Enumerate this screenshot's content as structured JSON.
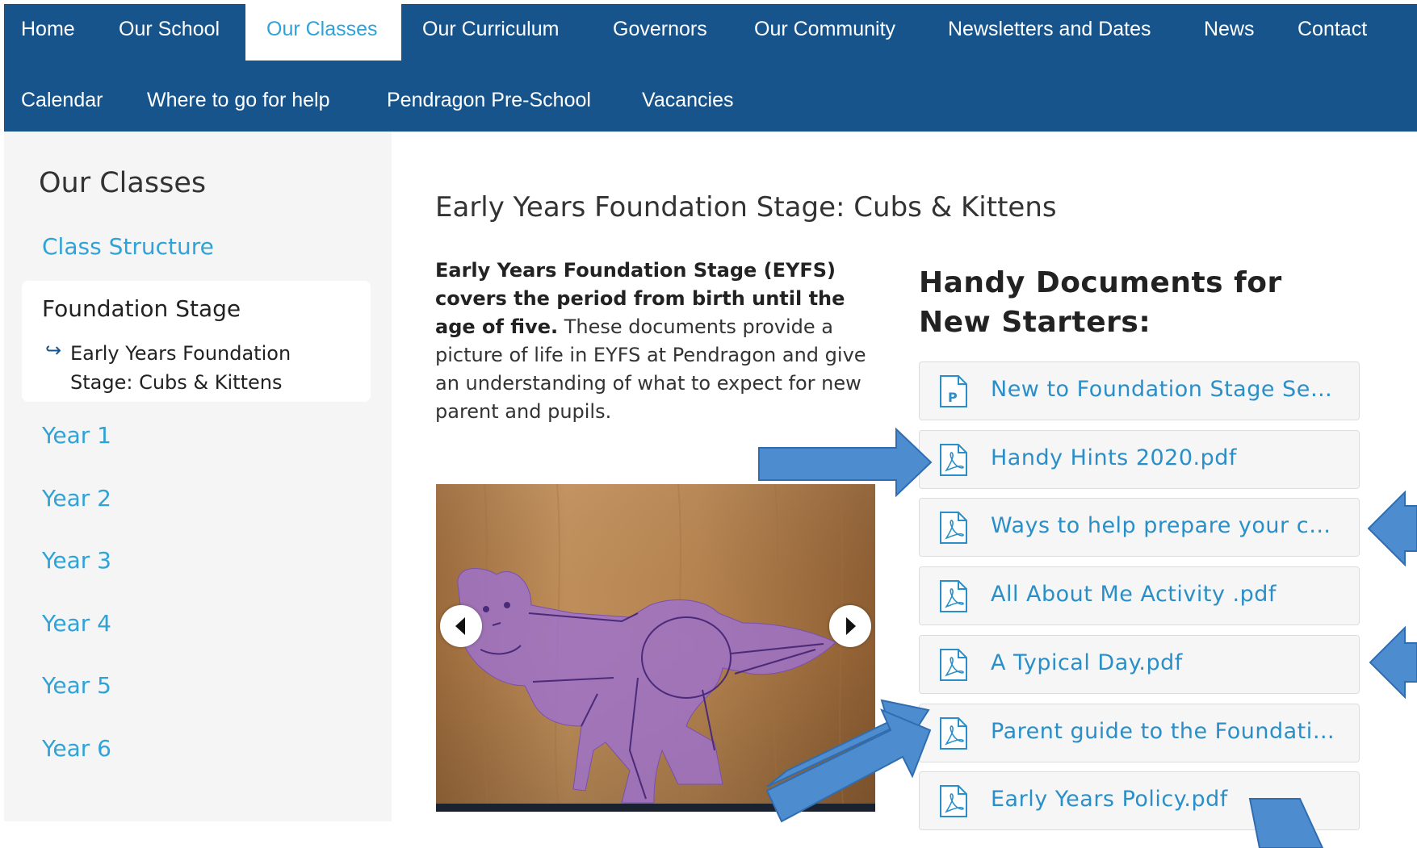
{
  "nav": {
    "row1": [
      "Home",
      "Our School",
      "Our Classes",
      "Our Curriculum",
      "Governors",
      "Our Community",
      "Newsletters and Dates",
      "News",
      "Contact"
    ],
    "row2": [
      "Calendar",
      "Where to go for help",
      "Pendragon Pre-School",
      "Vacancies"
    ],
    "active": "Our Classes"
  },
  "sidebar": {
    "title": "Our Classes",
    "class_structure": "Class Structure",
    "current": "Foundation Stage",
    "current_sub": "Early Years Foundation Stage: Cubs & Kittens",
    "years": [
      "Year 1",
      "Year 2",
      "Year 3",
      "Year 4",
      "Year 5",
      "Year 6"
    ]
  },
  "main": {
    "title": "Early Years Foundation Stage: Cubs & Kittens",
    "intro_bold": "Early Years Foundation Stage (EYFS) covers the period from birth until the age of five.",
    "intro_rest": "These documents provide a picture of life in EYFS at Pendragon and give an understanding of what to expect for new parent and pupils."
  },
  "documents": {
    "heading": "Handy Documents for New Starters:",
    "items": [
      {
        "label": "New to Foundation Stage Sep...",
        "icon": "powerpoint-file-icon"
      },
      {
        "label": "Handy Hints 2020.pdf",
        "icon": "pdf-file-icon"
      },
      {
        "label": "Ways to help prepare your chi...",
        "icon": "pdf-file-icon"
      },
      {
        "label": "All About Me Activity .pdf",
        "icon": "pdf-file-icon"
      },
      {
        "label": "A Typical Day.pdf",
        "icon": "pdf-file-icon"
      },
      {
        "label": "Parent guide to the Foundatio...",
        "icon": "pdf-file-icon"
      },
      {
        "label": "Early Years Policy.pdf",
        "icon": "pdf-file-icon"
      }
    ]
  },
  "carousel": {
    "prev_icon": "chevron-left-icon",
    "next_icon": "chevron-right-icon"
  },
  "colors": {
    "nav_bg": "#17548c",
    "accent": "#2fa3d8",
    "annotation_arrow": "#4d8dcf"
  }
}
